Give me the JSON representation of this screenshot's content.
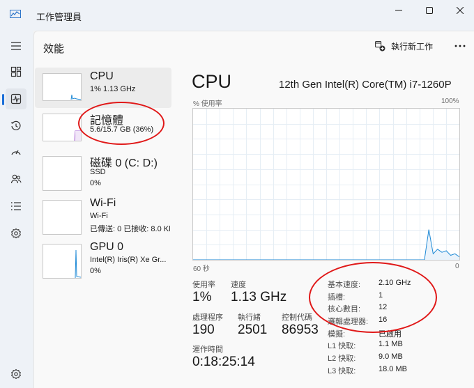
{
  "window": {
    "title": "工作管理員"
  },
  "header": {
    "page_title": "效能",
    "run_new_task": "執行新工作"
  },
  "devices": [
    {
      "name": "CPU",
      "line1": "1% 1.13 GHz",
      "line2": ""
    },
    {
      "name": "記憶體",
      "line1": "5.6/15.7 GB (36%)",
      "line2": ""
    },
    {
      "name": "磁碟 0 (C: D:)",
      "line1": "SSD",
      "line2": "0%"
    },
    {
      "name": "Wi-Fi",
      "line1": "Wi-Fi",
      "line2": "已傳送: 0 已接收: 8.0 Kl"
    },
    {
      "name": "GPU 0",
      "line1": "Intel(R) Iris(R) Xe Gr...",
      "line2": "0%"
    }
  ],
  "detail": {
    "title": "CPU",
    "model": "12th Gen Intel(R) Core(TM) i7-1260P",
    "usage_axis_label": "% 使用率",
    "axis_max": "100%",
    "time_label": "60 秒",
    "axis_min": "0"
  },
  "stats": {
    "usage_label": "使用率",
    "usage": "1%",
    "speed_label": "速度",
    "speed": "1.13 GHz",
    "processes_label": "處理程序",
    "processes": "190",
    "threads_label": "執行緒",
    "threads": "2501",
    "handles_label": "控制代碼",
    "handles": "86953",
    "uptime_label": "運作時間",
    "uptime": "0:18:25:14"
  },
  "specs": [
    {
      "key": "基本速度:",
      "value": "2.10 GHz"
    },
    {
      "key": "插槽:",
      "value": "1"
    },
    {
      "key": "核心數目:",
      "value": "12"
    },
    {
      "key": "邏輯處理器:",
      "value": "16"
    },
    {
      "key": "模擬:",
      "value": "已啟用"
    },
    {
      "key": "L1 快取:",
      "value": "1.1 MB"
    },
    {
      "key": "L2 快取:",
      "value": "9.0 MB"
    },
    {
      "key": "L3 快取:",
      "value": "18.0 MB"
    }
  ],
  "cpu_history_percent": [
    0,
    0,
    0,
    0,
    0,
    0,
    0,
    0,
    0,
    0,
    0,
    0,
    0,
    0,
    0,
    0,
    0,
    0,
    0,
    0,
    0,
    0,
    0,
    0,
    0,
    0,
    0,
    0,
    0,
    0,
    0,
    0,
    0,
    0,
    0,
    0,
    0,
    0,
    0,
    0,
    0,
    0,
    0,
    0,
    0,
    0,
    0,
    0,
    0,
    0,
    0,
    0,
    0,
    0,
    20,
    4,
    7,
    5,
    6,
    3,
    4,
    2
  ],
  "colors": {
    "accent": "#1a6ed8",
    "cpu_line": "#1f8ad6",
    "memory_line": "#a35bd0",
    "annotation": "#e01818"
  }
}
